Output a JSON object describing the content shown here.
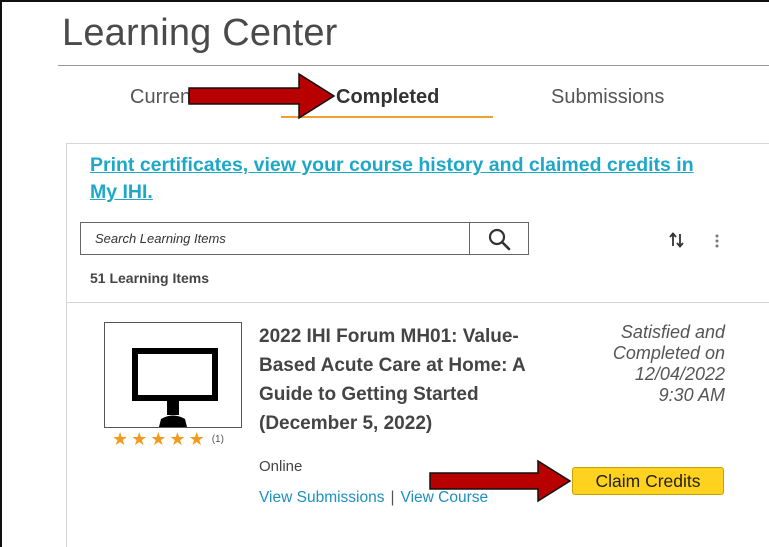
{
  "page": {
    "title": "Learning Center"
  },
  "tabs": [
    {
      "label": "Current"
    },
    {
      "label": "Completed"
    },
    {
      "label": "Submissions"
    }
  ],
  "panel": {
    "print_link_line1": "Print certificates, view your course history and claimed credits in",
    "print_link_line2": "My IHI.",
    "search": {
      "placeholder": "Search Learning Items"
    },
    "items_count": "51 Learning Items"
  },
  "course": {
    "title_lines": [
      "2022 IHI Forum MH01: Value-",
      "Based Acute Care at Home: A",
      "Guide to Getting Started",
      "(December 5, 2022)"
    ],
    "rating_stars": 5,
    "rating_count": "(1)",
    "status_lines": [
      "Satisfied and",
      "Completed on",
      "12/04/2022",
      "9:30 AM"
    ],
    "delivery": "Online",
    "view_submissions_label": "View Submissions",
    "separator": "|",
    "view_course_label": "View Course",
    "claim_label": "Claim Credits"
  },
  "colors": {
    "accent_link": "#1ea8c8",
    "tab_underline": "#f0a030",
    "star": "#f29a1e",
    "claim_button": "#ffd21f",
    "annotation_arrow": "#b80000"
  },
  "icons": {
    "search": "search-icon",
    "sort": "sort-icon",
    "more": "kebab-icon",
    "course_thumbnail": "monitor-icon",
    "annotation": "arrow-right-icon"
  }
}
